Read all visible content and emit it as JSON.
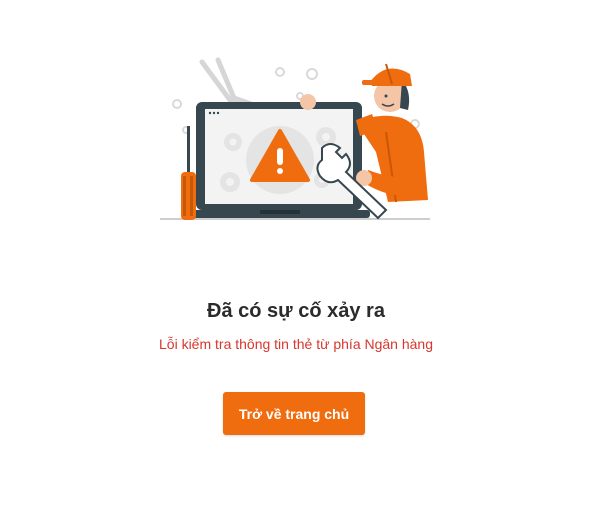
{
  "illustration": {
    "name": "worker-repairing-laptop-with-warning",
    "colors": {
      "orange": "#ef6c0f",
      "dark": "#37474f",
      "gear": "#e4e4e4",
      "skin": "#f5c5a8"
    }
  },
  "error": {
    "title": "Đã có sự cố xảy ra",
    "message": "Lỗi kiểm tra thông tin thẻ từ phía Ngân hàng"
  },
  "actions": {
    "home_label": "Trở về trang chủ"
  }
}
